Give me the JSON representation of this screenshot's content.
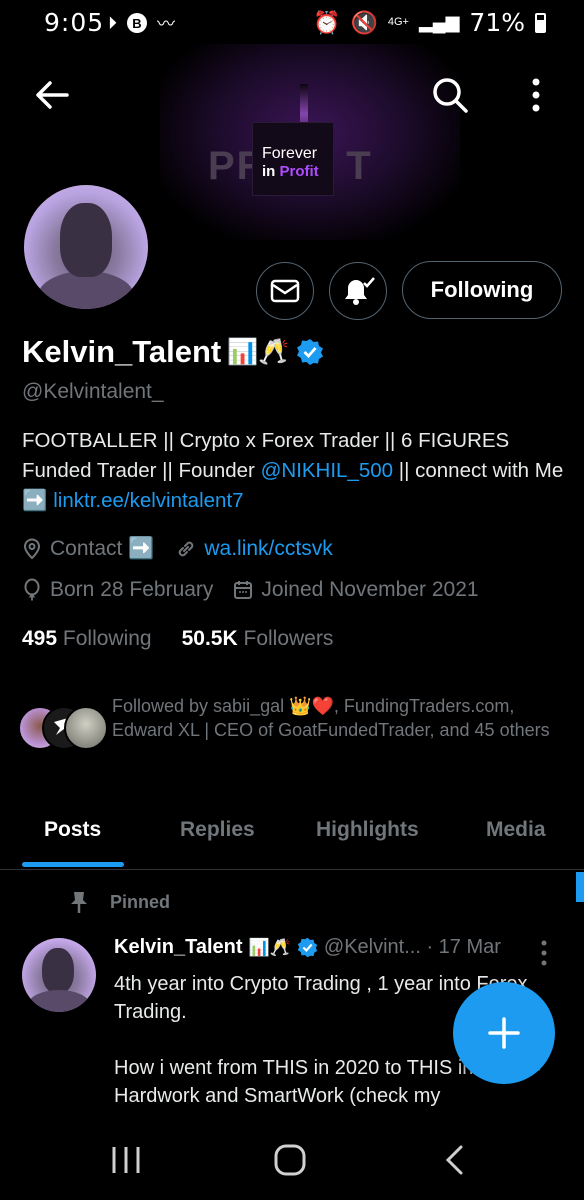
{
  "status_bar": {
    "time": "9:05",
    "network": "4G+",
    "battery": "71%"
  },
  "banner": {
    "line1": "Forever",
    "line2_prefix": "in",
    "line2_highlight": "Profit",
    "background_text": "PR      T"
  },
  "profile": {
    "name": "Kelvin_Talent",
    "name_emoji": "📊🥂",
    "handle": "@Kelvintalent_",
    "bio_part1": "FOOTBALLER || Crypto x Forex Trader || 6 FIGURES Funded Trader || Founder ",
    "bio_mention": "@NIKHIL_500",
    "bio_part2": " || connect with Me ",
    "bio_arrow": "➡️",
    "bio_link": "linktr.ee/kelvintalent7",
    "contact_label": "Contact ➡️",
    "website": "wa.link/cctsvk",
    "born": "Born 28 February",
    "joined": "Joined November 2021",
    "following_count": "495",
    "following_label": "Following",
    "followers_count": "50.5K",
    "followers_label": "Followers",
    "followed_by": "Followed by sabii_gal 👑❤️, FundingTraders.com, Edward XL | CEO of GoatFundedTrader, and 45 others"
  },
  "actions": {
    "following_button": "Following"
  },
  "tabs": [
    {
      "label": "Posts",
      "active": true
    },
    {
      "label": "Replies",
      "active": false
    },
    {
      "label": "Highlights",
      "active": false
    },
    {
      "label": "Media",
      "active": false
    }
  ],
  "pinned_post": {
    "pinned_label": "Pinned",
    "author": "Kelvin_Talent",
    "author_emoji": "📊🥂",
    "handle_date": "@Kelvint... · 17 Mar",
    "text": "4th year into Crypto Trading , 1 year into Forex Trading.\n\nHow i went from THIS in 2020 to THIS in 2024 = Hardwork and SmartWork (check my"
  },
  "colors": {
    "accent": "#1d9bf0",
    "background": "#000000",
    "muted": "#71767b",
    "border": "#536471"
  },
  "icons": {
    "back": "arrow-left-icon",
    "search": "search-icon",
    "more": "more-vertical-icon",
    "message": "envelope-icon",
    "notify": "bell-check-icon",
    "verified": "verified-badge-icon",
    "location": "location-pin-icon",
    "link": "link-icon",
    "birthday": "balloon-icon",
    "calendar": "calendar-icon",
    "pin": "pin-icon",
    "compose": "plus-icon"
  }
}
